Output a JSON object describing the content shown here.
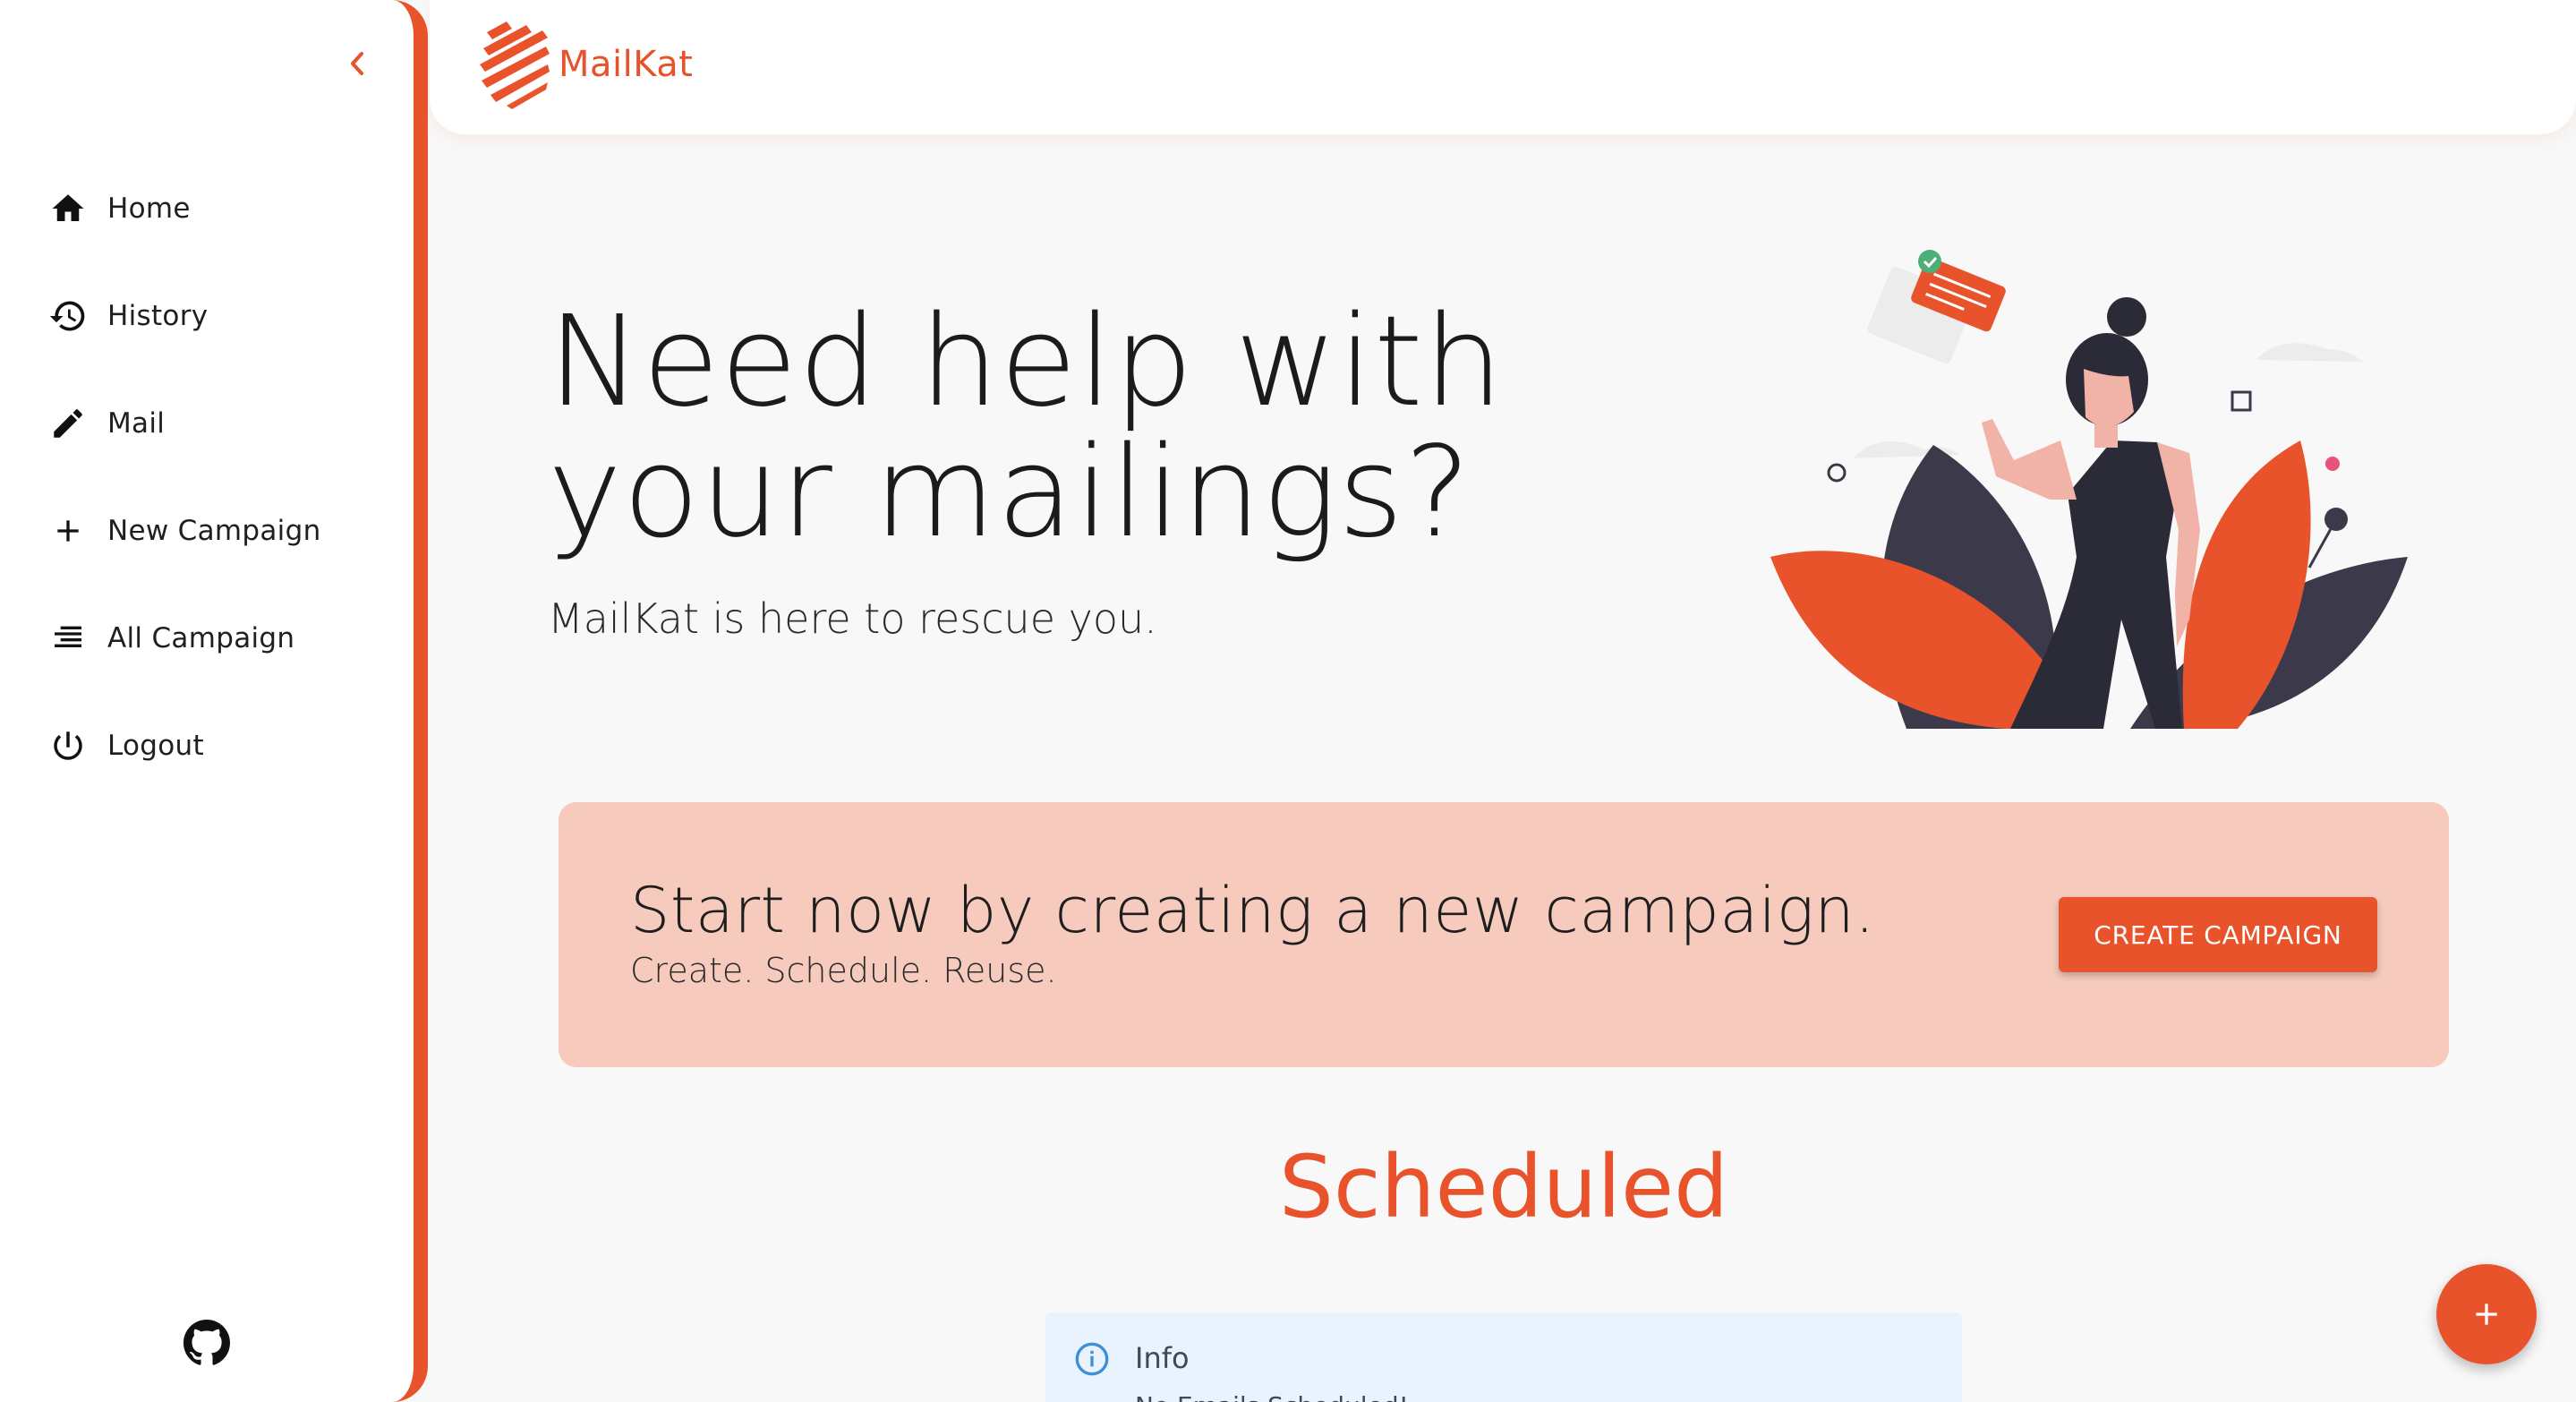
{
  "colors": {
    "accent": "#e8532b",
    "banner_bg": "#f6cabd",
    "info_bg": "#e8f3fd"
  },
  "brand": {
    "name": "MailKat"
  },
  "sidebar": {
    "items": [
      {
        "label": "Home",
        "icon": "home-icon"
      },
      {
        "label": "History",
        "icon": "history-icon"
      },
      {
        "label": "Mail",
        "icon": "pencil-icon"
      },
      {
        "label": "New Campaign",
        "icon": "plus-icon"
      },
      {
        "label": "All Campaign",
        "icon": "list-icon"
      },
      {
        "label": "Logout",
        "icon": "power-icon"
      }
    ],
    "footer_icon": "github-icon"
  },
  "hero": {
    "title_line1": "Need help with",
    "title_line2": "your mailings?",
    "subtitle": "MailKat is here to rescue you."
  },
  "banner": {
    "title": "Start now by creating a new campaign.",
    "subtitle": "Create. Schedule. Reuse.",
    "button_label": "CREATE CAMPAIGN"
  },
  "scheduled": {
    "title": "Scheduled",
    "info_title": "Info",
    "info_text": "No Emails Scheduled!"
  }
}
